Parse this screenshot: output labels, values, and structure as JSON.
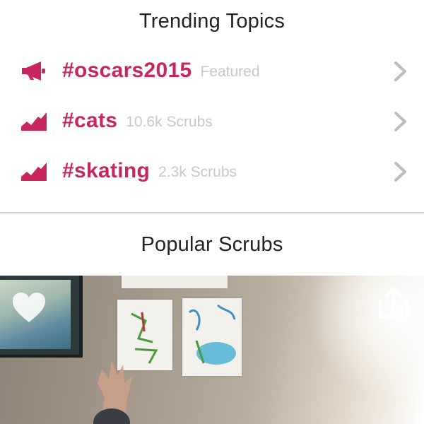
{
  "trending": {
    "title": "Trending Topics",
    "topics": [
      {
        "tag": "#oscars2015",
        "meta": "Featured",
        "icon": "megaphone-icon"
      },
      {
        "tag": "#cats",
        "meta": "10.6k Scrubs",
        "icon": "trending-chart-icon"
      },
      {
        "tag": "#skating",
        "meta": "2.3k Scrubs",
        "icon": "trending-chart-icon"
      }
    ]
  },
  "popular": {
    "title": "Popular Scrubs"
  },
  "colors": {
    "accent": "#c8265f",
    "meta_text": "#c8c8c8",
    "chevron": "#bdbdbd",
    "divider": "#cfcfcf"
  }
}
